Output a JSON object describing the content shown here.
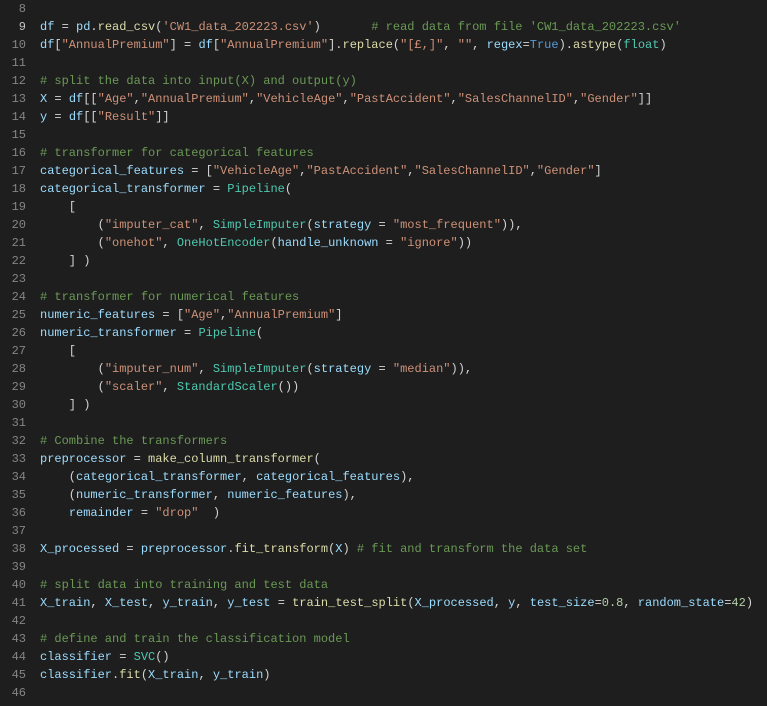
{
  "lines": [
    {
      "num": 8,
      "tokens": []
    },
    {
      "num": 9,
      "active": true,
      "tokens": [
        {
          "t": "df",
          "c": "var"
        },
        {
          "t": " = "
        },
        {
          "t": "pd",
          "c": "var"
        },
        {
          "t": "."
        },
        {
          "t": "read_csv",
          "c": "func"
        },
        {
          "t": "("
        },
        {
          "t": "'CW1_data_202223.csv'",
          "c": "string"
        },
        {
          "t": ")       "
        },
        {
          "t": "# read data from file 'CW1_data_202223.csv'",
          "c": "comment"
        }
      ]
    },
    {
      "num": 10,
      "tokens": [
        {
          "t": "df",
          "c": "var"
        },
        {
          "t": "["
        },
        {
          "t": "\"AnnualPremium\"",
          "c": "string"
        },
        {
          "t": "] = "
        },
        {
          "t": "df",
          "c": "var"
        },
        {
          "t": "["
        },
        {
          "t": "\"AnnualPremium\"",
          "c": "string"
        },
        {
          "t": "]."
        },
        {
          "t": "replace",
          "c": "func"
        },
        {
          "t": "("
        },
        {
          "t": "\"[£,]\"",
          "c": "string"
        },
        {
          "t": ", "
        },
        {
          "t": "\"\"",
          "c": "string"
        },
        {
          "t": ", "
        },
        {
          "t": "regex",
          "c": "var"
        },
        {
          "t": "="
        },
        {
          "t": "True",
          "c": "const"
        },
        {
          "t": ")."
        },
        {
          "t": "astype",
          "c": "func"
        },
        {
          "t": "("
        },
        {
          "t": "float",
          "c": "class"
        },
        {
          "t": ")"
        }
      ]
    },
    {
      "num": 11,
      "tokens": []
    },
    {
      "num": 12,
      "tokens": [
        {
          "t": "# split the data into input(X) and output(y)",
          "c": "comment"
        }
      ]
    },
    {
      "num": 13,
      "tokens": [
        {
          "t": "X",
          "c": "var"
        },
        {
          "t": " = "
        },
        {
          "t": "df",
          "c": "var"
        },
        {
          "t": "[["
        },
        {
          "t": "\"Age\"",
          "c": "string"
        },
        {
          "t": ","
        },
        {
          "t": "\"AnnualPremium\"",
          "c": "string"
        },
        {
          "t": ","
        },
        {
          "t": "\"VehicleAge\"",
          "c": "string"
        },
        {
          "t": ","
        },
        {
          "t": "\"PastAccident\"",
          "c": "string"
        },
        {
          "t": ","
        },
        {
          "t": "\"SalesChannelID\"",
          "c": "string"
        },
        {
          "t": ","
        },
        {
          "t": "\"Gender\"",
          "c": "string"
        },
        {
          "t": "]]"
        }
      ]
    },
    {
      "num": 14,
      "tokens": [
        {
          "t": "y",
          "c": "var"
        },
        {
          "t": " = "
        },
        {
          "t": "df",
          "c": "var"
        },
        {
          "t": "[["
        },
        {
          "t": "\"Result\"",
          "c": "string"
        },
        {
          "t": "]]"
        }
      ]
    },
    {
      "num": 15,
      "tokens": []
    },
    {
      "num": 16,
      "tokens": [
        {
          "t": "# transformer for categorical features",
          "c": "comment"
        }
      ]
    },
    {
      "num": 17,
      "tokens": [
        {
          "t": "categorical_features",
          "c": "var"
        },
        {
          "t": " = ["
        },
        {
          "t": "\"VehicleAge\"",
          "c": "string"
        },
        {
          "t": ","
        },
        {
          "t": "\"PastAccident\"",
          "c": "string"
        },
        {
          "t": ","
        },
        {
          "t": "\"SalesChannelID\"",
          "c": "string"
        },
        {
          "t": ","
        },
        {
          "t": "\"Gender\"",
          "c": "string"
        },
        {
          "t": "]"
        }
      ]
    },
    {
      "num": 18,
      "tokens": [
        {
          "t": "categorical_transformer",
          "c": "var"
        },
        {
          "t": " = "
        },
        {
          "t": "Pipeline",
          "c": "class"
        },
        {
          "t": "("
        }
      ]
    },
    {
      "num": 19,
      "tokens": [
        {
          "t": "    ["
        }
      ]
    },
    {
      "num": 20,
      "tokens": [
        {
          "t": "        ("
        },
        {
          "t": "\"imputer_cat\"",
          "c": "string"
        },
        {
          "t": ", "
        },
        {
          "t": "SimpleImputer",
          "c": "class"
        },
        {
          "t": "("
        },
        {
          "t": "strategy",
          "c": "var"
        },
        {
          "t": " = "
        },
        {
          "t": "\"most_frequent\"",
          "c": "string"
        },
        {
          "t": ")),"
        }
      ]
    },
    {
      "num": 21,
      "tokens": [
        {
          "t": "        ("
        },
        {
          "t": "\"onehot\"",
          "c": "string"
        },
        {
          "t": ", "
        },
        {
          "t": "OneHotEncoder",
          "c": "class"
        },
        {
          "t": "("
        },
        {
          "t": "handle_unknown",
          "c": "var"
        },
        {
          "t": " = "
        },
        {
          "t": "\"ignore\"",
          "c": "string"
        },
        {
          "t": "))"
        }
      ]
    },
    {
      "num": 22,
      "tokens": [
        {
          "t": "    ] )"
        }
      ]
    },
    {
      "num": 23,
      "tokens": []
    },
    {
      "num": 24,
      "tokens": [
        {
          "t": "# transformer for numerical features",
          "c": "comment"
        }
      ]
    },
    {
      "num": 25,
      "tokens": [
        {
          "t": "numeric_features",
          "c": "var"
        },
        {
          "t": " = ["
        },
        {
          "t": "\"Age\"",
          "c": "string"
        },
        {
          "t": ","
        },
        {
          "t": "\"AnnualPremium\"",
          "c": "string"
        },
        {
          "t": "]"
        }
      ]
    },
    {
      "num": 26,
      "tokens": [
        {
          "t": "numeric_transformer",
          "c": "var"
        },
        {
          "t": " = "
        },
        {
          "t": "Pipeline",
          "c": "class"
        },
        {
          "t": "("
        }
      ]
    },
    {
      "num": 27,
      "tokens": [
        {
          "t": "    ["
        }
      ]
    },
    {
      "num": 28,
      "tokens": [
        {
          "t": "        ("
        },
        {
          "t": "\"imputer_num\"",
          "c": "string"
        },
        {
          "t": ", "
        },
        {
          "t": "SimpleImputer",
          "c": "class"
        },
        {
          "t": "("
        },
        {
          "t": "strategy",
          "c": "var"
        },
        {
          "t": " = "
        },
        {
          "t": "\"median\"",
          "c": "string"
        },
        {
          "t": ")),"
        }
      ]
    },
    {
      "num": 29,
      "tokens": [
        {
          "t": "        ("
        },
        {
          "t": "\"scaler\"",
          "c": "string"
        },
        {
          "t": ", "
        },
        {
          "t": "StandardScaler",
          "c": "class"
        },
        {
          "t": "())"
        }
      ]
    },
    {
      "num": 30,
      "tokens": [
        {
          "t": "    ] )"
        }
      ]
    },
    {
      "num": 31,
      "tokens": []
    },
    {
      "num": 32,
      "tokens": [
        {
          "t": "# Combine the transformers",
          "c": "comment"
        }
      ]
    },
    {
      "num": 33,
      "tokens": [
        {
          "t": "preprocessor",
          "c": "var"
        },
        {
          "t": " = "
        },
        {
          "t": "make_column_transformer",
          "c": "func"
        },
        {
          "t": "("
        }
      ]
    },
    {
      "num": 34,
      "tokens": [
        {
          "t": "    ("
        },
        {
          "t": "categorical_transformer",
          "c": "var"
        },
        {
          "t": ", "
        },
        {
          "t": "categorical_features",
          "c": "var"
        },
        {
          "t": "),"
        }
      ]
    },
    {
      "num": 35,
      "tokens": [
        {
          "t": "    ("
        },
        {
          "t": "numeric_transformer",
          "c": "var"
        },
        {
          "t": ", "
        },
        {
          "t": "numeric_features",
          "c": "var"
        },
        {
          "t": "),"
        }
      ]
    },
    {
      "num": 36,
      "tokens": [
        {
          "t": "    "
        },
        {
          "t": "remainder",
          "c": "var"
        },
        {
          "t": " = "
        },
        {
          "t": "\"drop\"",
          "c": "string"
        },
        {
          "t": "  )"
        }
      ]
    },
    {
      "num": 37,
      "tokens": []
    },
    {
      "num": 38,
      "tokens": [
        {
          "t": "X_processed",
          "c": "var"
        },
        {
          "t": " = "
        },
        {
          "t": "preprocessor",
          "c": "var"
        },
        {
          "t": "."
        },
        {
          "t": "fit_transform",
          "c": "func"
        },
        {
          "t": "("
        },
        {
          "t": "X",
          "c": "var"
        },
        {
          "t": ") "
        },
        {
          "t": "# fit and transform the data set",
          "c": "comment"
        }
      ]
    },
    {
      "num": 39,
      "tokens": []
    },
    {
      "num": 40,
      "tokens": [
        {
          "t": "# split data into training and test data",
          "c": "comment"
        }
      ]
    },
    {
      "num": 41,
      "tokens": [
        {
          "t": "X_train",
          "c": "var"
        },
        {
          "t": ", "
        },
        {
          "t": "X_test",
          "c": "var"
        },
        {
          "t": ", "
        },
        {
          "t": "y_train",
          "c": "var"
        },
        {
          "t": ", "
        },
        {
          "t": "y_test",
          "c": "var"
        },
        {
          "t": " = "
        },
        {
          "t": "train_test_split",
          "c": "func"
        },
        {
          "t": "("
        },
        {
          "t": "X_processed",
          "c": "var"
        },
        {
          "t": ", "
        },
        {
          "t": "y",
          "c": "var"
        },
        {
          "t": ", "
        },
        {
          "t": "test_size",
          "c": "var"
        },
        {
          "t": "="
        },
        {
          "t": "0.8",
          "c": "num"
        },
        {
          "t": ", "
        },
        {
          "t": "random_state",
          "c": "var"
        },
        {
          "t": "="
        },
        {
          "t": "42",
          "c": "num"
        },
        {
          "t": ")"
        }
      ]
    },
    {
      "num": 42,
      "tokens": []
    },
    {
      "num": 43,
      "tokens": [
        {
          "t": "# define and train the classification model",
          "c": "comment"
        }
      ]
    },
    {
      "num": 44,
      "tokens": [
        {
          "t": "classifier",
          "c": "var"
        },
        {
          "t": " = "
        },
        {
          "t": "SVC",
          "c": "class"
        },
        {
          "t": "()"
        }
      ]
    },
    {
      "num": 45,
      "tokens": [
        {
          "t": "classifier",
          "c": "var"
        },
        {
          "t": "."
        },
        {
          "t": "fit",
          "c": "func"
        },
        {
          "t": "("
        },
        {
          "t": "X_train",
          "c": "var"
        },
        {
          "t": ", "
        },
        {
          "t": "y_train",
          "c": "var"
        },
        {
          "t": ")"
        }
      ]
    },
    {
      "num": 46,
      "tokens": []
    }
  ]
}
